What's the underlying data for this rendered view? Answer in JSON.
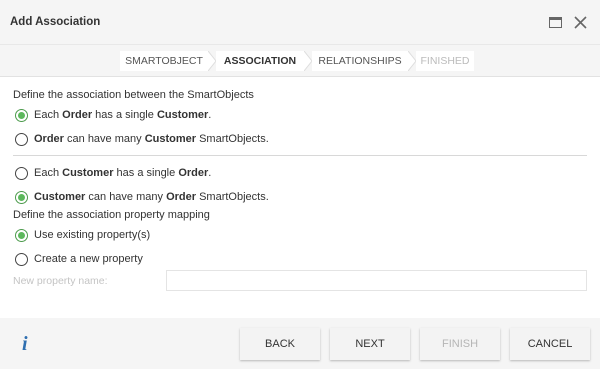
{
  "dialog": {
    "title": "Add Association"
  },
  "wizard": {
    "steps": [
      {
        "label": "SMARTOBJECT",
        "state": "done"
      },
      {
        "label": "ASSOCIATION",
        "state": "active"
      },
      {
        "label": "RELATIONSHIPS",
        "state": "pending"
      },
      {
        "label": "FINISHED",
        "state": "disabled"
      }
    ]
  },
  "association": {
    "heading": "Define the association between the SmartObjects",
    "order_side": [
      {
        "parts": [
          "Each ",
          "Order",
          " has a single ",
          "Customer",
          "."
        ],
        "selected": true
      },
      {
        "parts": [
          "",
          "Order",
          " can have many ",
          "Customer",
          " SmartObjects."
        ],
        "selected": false
      }
    ],
    "customer_side": [
      {
        "parts": [
          "Each ",
          "Customer",
          " has a single ",
          "Order",
          "."
        ],
        "selected": false
      },
      {
        "parts": [
          "",
          "Customer",
          " can have many ",
          "Order",
          " SmartObjects."
        ],
        "selected": true
      }
    ]
  },
  "mapping": {
    "heading": "Define the association property mapping",
    "options": [
      {
        "label": "Use existing property(s)",
        "selected": true
      },
      {
        "label": "Create a new property",
        "selected": false
      }
    ],
    "new_property_label": "New property name:",
    "new_property_value": ""
  },
  "footer": {
    "info_icon": "i",
    "buttons": {
      "back": "BACK",
      "next": "NEXT",
      "finish": "FINISH",
      "cancel": "CANCEL"
    }
  },
  "colors": {
    "radio_selected": "#5cb85c",
    "info_icon": "#2f6fb0",
    "disabled_text": "#bbbbbb"
  }
}
